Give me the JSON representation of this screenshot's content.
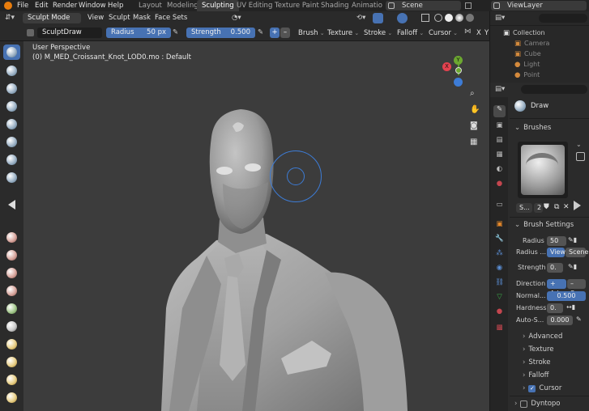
{
  "menubar": {
    "items": [
      "File",
      "Edit",
      "Render",
      "Window",
      "Help"
    ]
  },
  "workspaces": [
    "Layout",
    "Modeling",
    "Sculpting",
    "UV Editing",
    "Texture Paint",
    "Shading",
    "Animatio"
  ],
  "active_workspace": "Sculpting",
  "scene": "Scene",
  "view_layer": "ViewLayer",
  "header": {
    "mode": "Sculpt Mode",
    "menus": [
      "View",
      "Sculpt",
      "Mask",
      "Face Sets"
    ]
  },
  "tool_settings": {
    "brush_name": "SculptDraw",
    "radius_label": "Radius",
    "radius_value": "50 px",
    "strength_label": "Strength",
    "strength_value": "0.500",
    "menus": [
      "Brush",
      "Texture",
      "Stroke",
      "Falloff",
      "Cursor"
    ],
    "axis": [
      "X",
      "Y"
    ]
  },
  "viewport": {
    "title": "User Perspective",
    "object": "(0) M_MED_Croissant_Knot_LOD0.mo : Default"
  },
  "gizmo": {
    "x": "X",
    "y": "Y",
    "z": "Z"
  },
  "outliner": {
    "items": [
      "Collection",
      "Camera",
      "Cube",
      "Light",
      "Point"
    ]
  },
  "properties": {
    "brush": "Draw",
    "brushes_header": "Brushes",
    "brush_short": "S...",
    "brush_users": "2",
    "settings_header": "Brush Settings",
    "radius_label": "Radius",
    "radius_value": "50",
    "radius_unit_label": "Radius ...",
    "radius_view": "View",
    "radius_scene": "Scene",
    "strength_label": "Strength",
    "strength_value": "0.",
    "direction_label": "Direction",
    "direction_add": "+ Ad",
    "direction_sub": "– Su",
    "normal_label": "Normal...",
    "normal_value": "0.500",
    "hardness_label": "Hardness",
    "hardness_value": "0.",
    "autosmooth_label": "Auto-S...",
    "autosmooth_value": "0.000",
    "panels": [
      "Advanced",
      "Texture",
      "Stroke",
      "Falloff",
      "Cursor",
      "Dyntopo"
    ]
  },
  "colors": {
    "accent": "#4772b3",
    "gizmo_x": "#e4424f",
    "gizmo_y": "#6ca830",
    "gizmo_z": "#3d7cd6"
  }
}
